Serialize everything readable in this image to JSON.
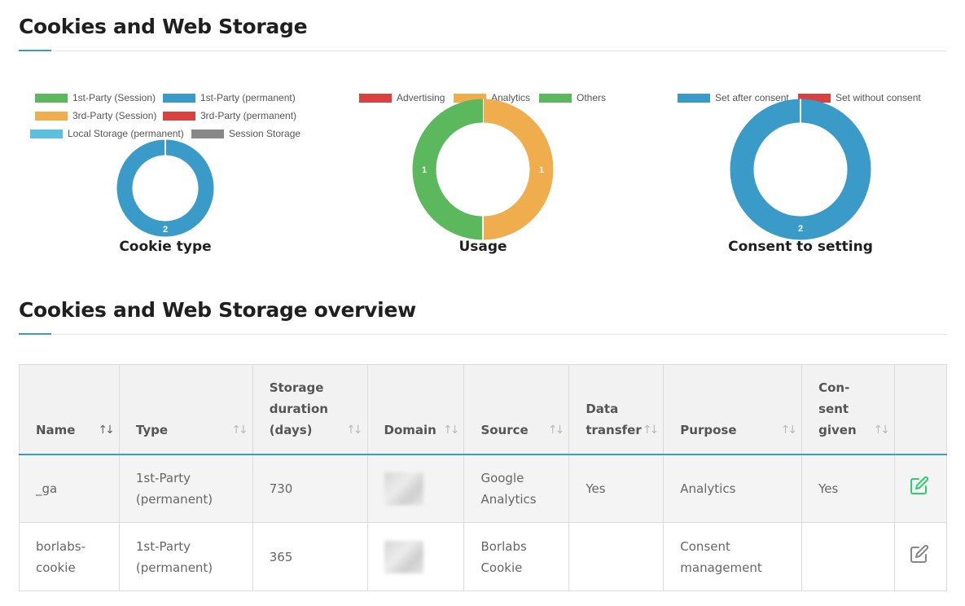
{
  "section1": {
    "title": "Cookies and Web Storage"
  },
  "section2": {
    "title": "Cookies and Web Storage overview"
  },
  "charts": [
    {
      "caption": "Cookie type",
      "legend": [
        {
          "label": "1st-Party (Session)",
          "color": "#5cb85c"
        },
        {
          "label": "1st-Party (permanent)",
          "color": "#3a9bc9"
        },
        {
          "label": "3rd-Party (Session)",
          "color": "#f0ad4e"
        },
        {
          "label": "3rd-Party (permanent)",
          "color": "#d9403f"
        },
        {
          "label": "Local Storage (permanent)",
          "color": "#5bc0de"
        },
        {
          "label": "Session Storage",
          "color": "#888888"
        }
      ]
    },
    {
      "caption": "Usage",
      "legend": [
        {
          "label": "Advertising",
          "color": "#d9403f"
        },
        {
          "label": "Analytics",
          "color": "#f0ad4e"
        },
        {
          "label": "Others",
          "color": "#5cb85c"
        }
      ]
    },
    {
      "caption": "Consent to setting",
      "legend": [
        {
          "label": "Set after consent",
          "color": "#3a9bc9"
        },
        {
          "label": "Set without consent",
          "color": "#d9403f"
        }
      ]
    }
  ],
  "chart_data": [
    {
      "type": "pie",
      "title": "Cookie type",
      "categories": [
        "1st-Party (Session)",
        "1st-Party (permanent)",
        "3rd-Party (Session)",
        "3rd-Party (permanent)",
        "Local Storage (permanent)",
        "Session Storage"
      ],
      "values": [
        0,
        2,
        0,
        0,
        0,
        0
      ],
      "colors": [
        "#5cb85c",
        "#3a9bc9",
        "#f0ad4e",
        "#d9403f",
        "#5bc0de",
        "#888888"
      ]
    },
    {
      "type": "pie",
      "title": "Usage",
      "categories": [
        "Advertising",
        "Analytics",
        "Others"
      ],
      "values": [
        0,
        1,
        1
      ],
      "colors": [
        "#d9403f",
        "#f0ad4e",
        "#5cb85c"
      ]
    },
    {
      "type": "pie",
      "title": "Consent to setting",
      "categories": [
        "Set after consent",
        "Set without consent"
      ],
      "values": [
        2,
        0
      ],
      "colors": [
        "#3a9bc9",
        "#d9403f"
      ]
    }
  ],
  "table": {
    "headers": [
      {
        "lines": [
          "Name"
        ]
      },
      {
        "lines": [
          "Type"
        ]
      },
      {
        "lines": [
          "Storage",
          "duration",
          "(days)"
        ]
      },
      {
        "lines": [
          "Domain"
        ]
      },
      {
        "lines": [
          "Source"
        ]
      },
      {
        "lines": [
          "Data",
          "transfer"
        ]
      },
      {
        "lines": [
          "Purpose"
        ]
      },
      {
        "lines": [
          "Con-",
          "sent",
          "given"
        ]
      }
    ],
    "rows": [
      {
        "name": "_ga",
        "type": [
          "1st-Party",
          "(permanent)"
        ],
        "duration": "730",
        "source": [
          "Google",
          "Analytics"
        ],
        "transfer": "Yes",
        "purpose": [
          "Analytics"
        ],
        "consent": "Yes",
        "edit_icon": "edit-icon",
        "edit_color": "#2ecc71"
      },
      {
        "name": [
          "borlabs-",
          "cookie"
        ],
        "type": [
          "1st-Party",
          "(permanent)"
        ],
        "duration": "365",
        "source": [
          "Borlabs",
          "Cookie"
        ],
        "transfer": "",
        "purpose": [
          "Consent",
          "management"
        ],
        "consent": "",
        "edit_icon": "edit-icon",
        "edit_color": "#888888"
      }
    ]
  }
}
